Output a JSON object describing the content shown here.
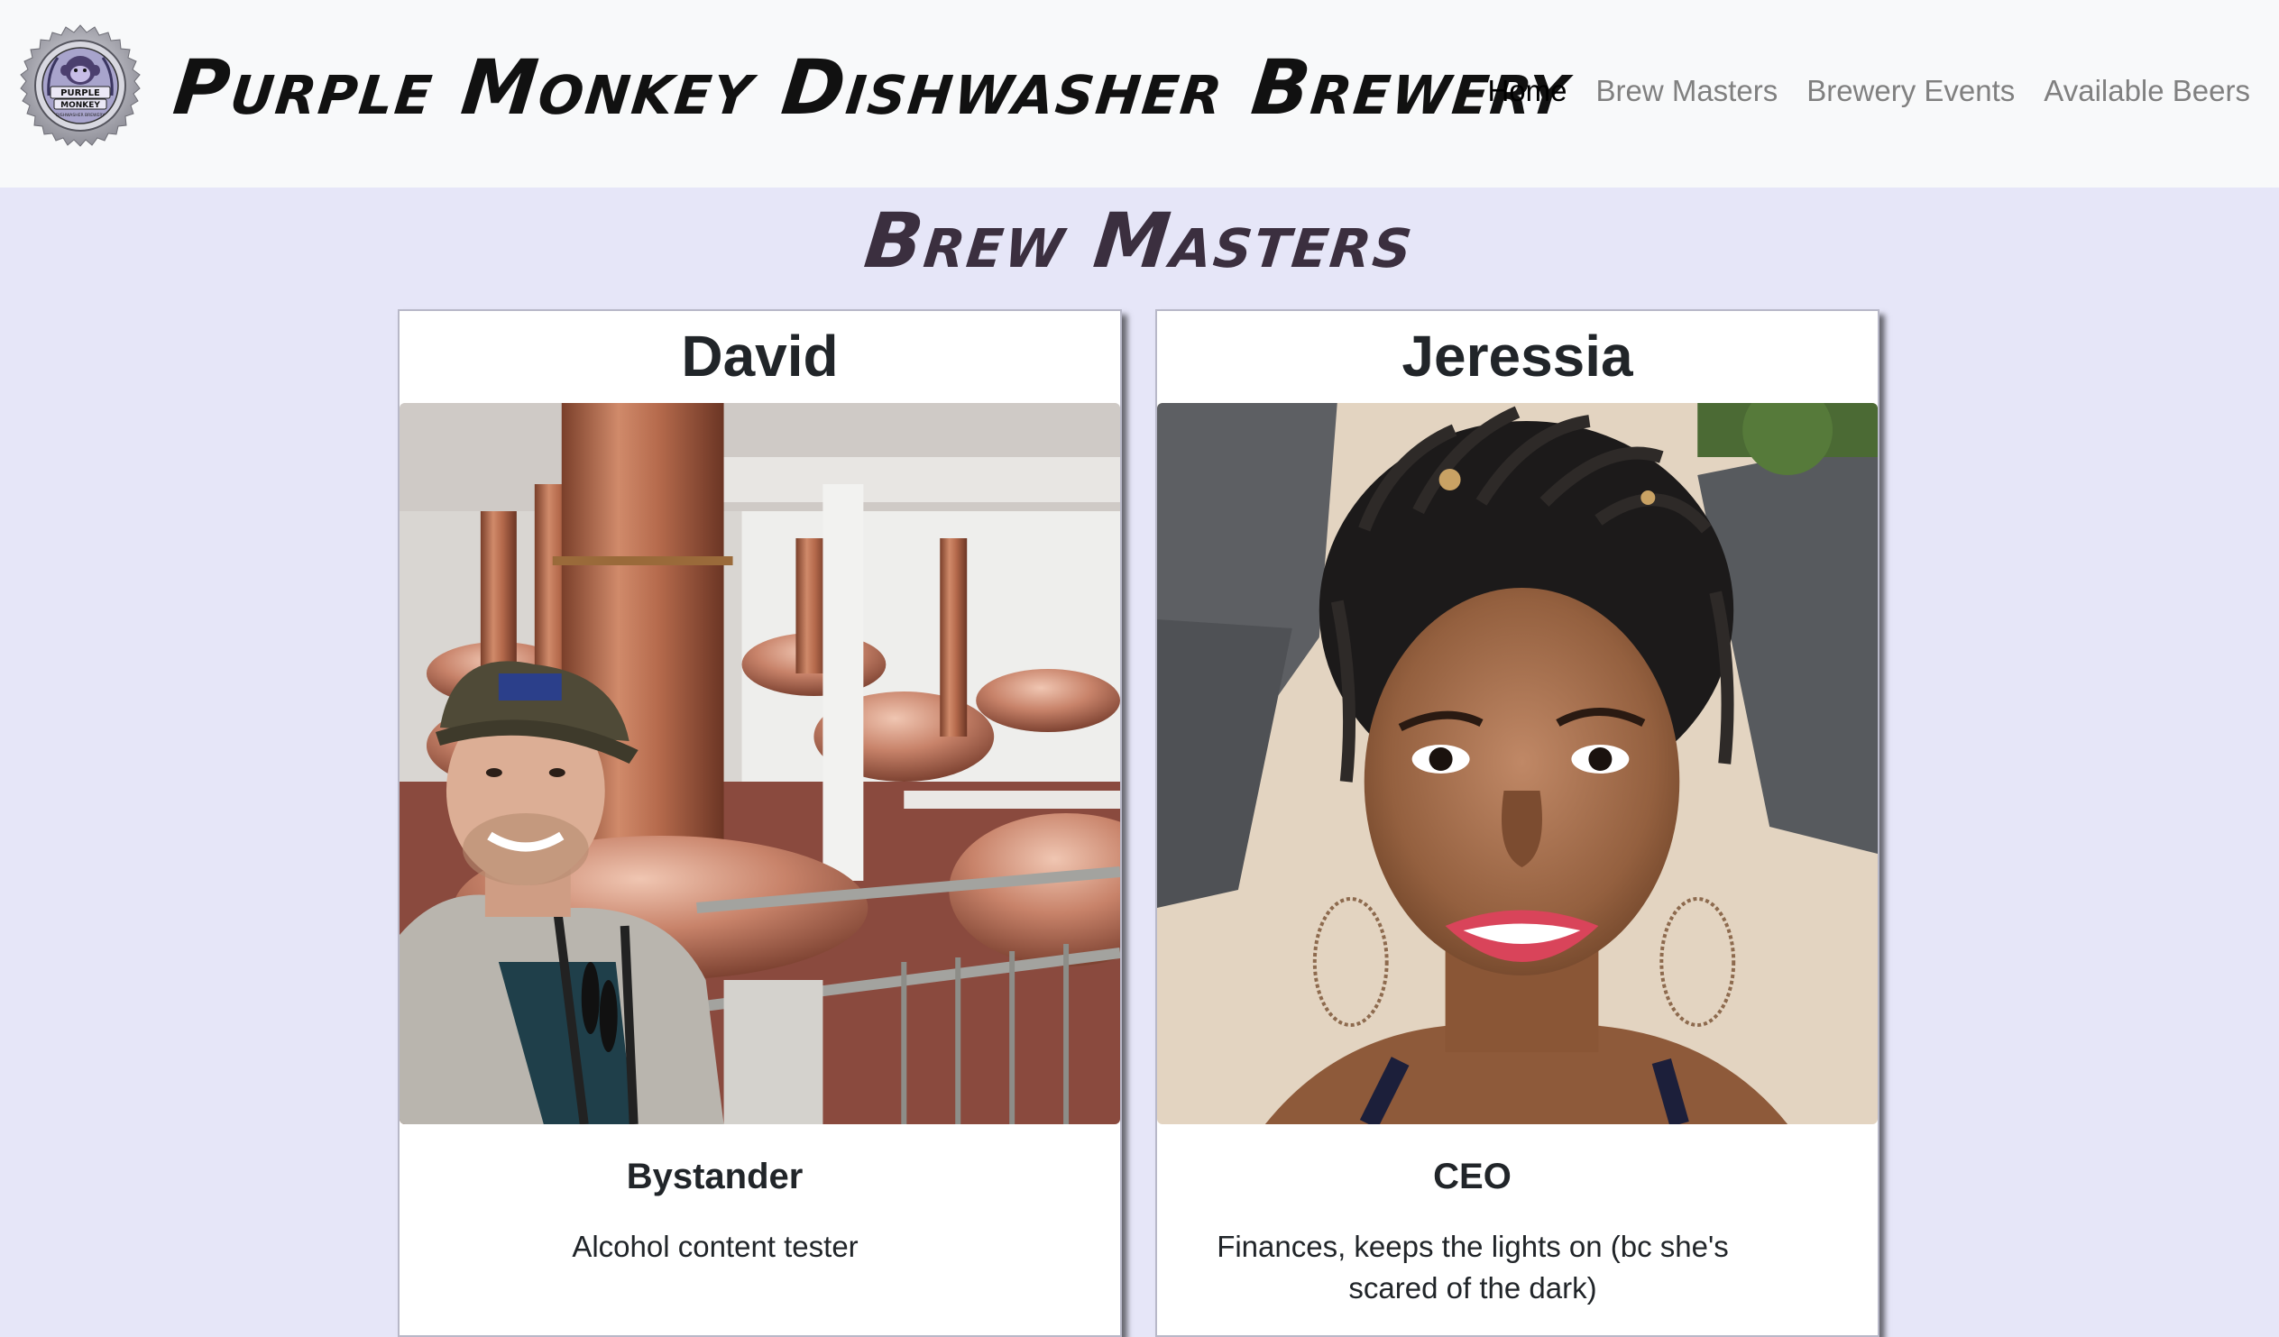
{
  "brand": {
    "name": "Purple Monkey Dishwasher Brewery",
    "logo_text_top": "PURPLE",
    "logo_text_bottom": "MONKEY",
    "logo_text_small": "DISHWASHER BREWERY"
  },
  "nav": {
    "items": [
      {
        "label": "Home",
        "active": true
      },
      {
        "label": "Brew Masters",
        "active": false
      },
      {
        "label": "Brewery Events",
        "active": false
      },
      {
        "label": "Available Beers",
        "active": false
      }
    ]
  },
  "page": {
    "title": "Brew Masters"
  },
  "masters": [
    {
      "name": "David",
      "photo_alt": "Man in a cap taking a selfie in front of copper brewing kettles",
      "role": "Bystander",
      "description": "Alcohol content tester"
    },
    {
      "name": "Jeressia",
      "photo_alt": "Smiling woman with braided hair and hoop earrings at a beach",
      "role": "CEO",
      "description": "Finances, keeps the lights on (bc she's scared of the dark)"
    }
  ],
  "colors": {
    "page_background": "#e6e6f8",
    "navbar_background": "#f8f9fa",
    "nav_active": "#000000",
    "nav_inactive": "#808080",
    "title": "#3b2f3f"
  }
}
